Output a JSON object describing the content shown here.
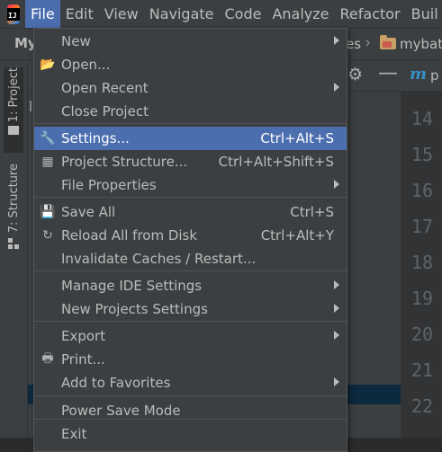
{
  "menubar": {
    "items": [
      {
        "label": "File",
        "active": true
      },
      {
        "label": "Edit"
      },
      {
        "label": "View"
      },
      {
        "label": "Navigate"
      },
      {
        "label": "Code"
      },
      {
        "label": "Analyze"
      },
      {
        "label": "Refactor"
      },
      {
        "label": "Buil"
      }
    ]
  },
  "nav": {
    "project_label": "My",
    "crumb_partial": "es",
    "crumb_file": "mybat"
  },
  "toolbar": {
    "tab_partial": "p"
  },
  "sidebar": {
    "project_tab": "1: Project",
    "structure_tab": "7: Structure"
  },
  "editor": {
    "line_numbers": [
      "14",
      "15",
      "16",
      "17",
      "18",
      "19",
      "20",
      "21",
      "22"
    ]
  },
  "file_menu": {
    "items": [
      {
        "label": "New",
        "shortcut": "",
        "submenu": true,
        "icon": ""
      },
      {
        "label": "Open...",
        "shortcut": "",
        "submenu": false,
        "icon": "folder-open-icon"
      },
      {
        "label": "Open Recent",
        "shortcut": "",
        "submenu": true,
        "icon": ""
      },
      {
        "label": "Close Project",
        "shortcut": "",
        "submenu": false,
        "icon": ""
      },
      {
        "label": "Settings...",
        "shortcut": "Ctrl+Alt+S",
        "submenu": false,
        "icon": "wrench-icon",
        "highlighted": true
      },
      {
        "label": "Project Structure...",
        "shortcut": "Ctrl+Alt+Shift+S",
        "submenu": false,
        "icon": "project-structure-icon"
      },
      {
        "label": "File Properties",
        "shortcut": "",
        "submenu": true,
        "icon": ""
      },
      {
        "label": "Save All",
        "shortcut": "Ctrl+S",
        "submenu": false,
        "icon": "save-icon"
      },
      {
        "label": "Reload All from Disk",
        "shortcut": "Ctrl+Alt+Y",
        "submenu": false,
        "icon": "reload-icon"
      },
      {
        "label": "Invalidate Caches / Restart...",
        "shortcut": "",
        "submenu": false,
        "icon": ""
      },
      {
        "label": "Manage IDE Settings",
        "shortcut": "",
        "submenu": true,
        "icon": ""
      },
      {
        "label": "New Projects Settings",
        "shortcut": "",
        "submenu": true,
        "icon": ""
      },
      {
        "label": "Export",
        "shortcut": "",
        "submenu": true,
        "icon": ""
      },
      {
        "label": "Print...",
        "shortcut": "",
        "submenu": false,
        "icon": "printer-icon"
      },
      {
        "label": "Add to Favorites",
        "shortcut": "",
        "submenu": true,
        "icon": ""
      },
      {
        "label": "Power Save Mode",
        "shortcut": "",
        "submenu": false,
        "icon": ""
      },
      {
        "label": "Exit",
        "shortcut": "",
        "submenu": false,
        "icon": ""
      }
    ]
  },
  "colors": {
    "highlight": "#4b6eaf",
    "menu_bg": "#3c3f41",
    "editor_bg": "#2b2b2b"
  }
}
